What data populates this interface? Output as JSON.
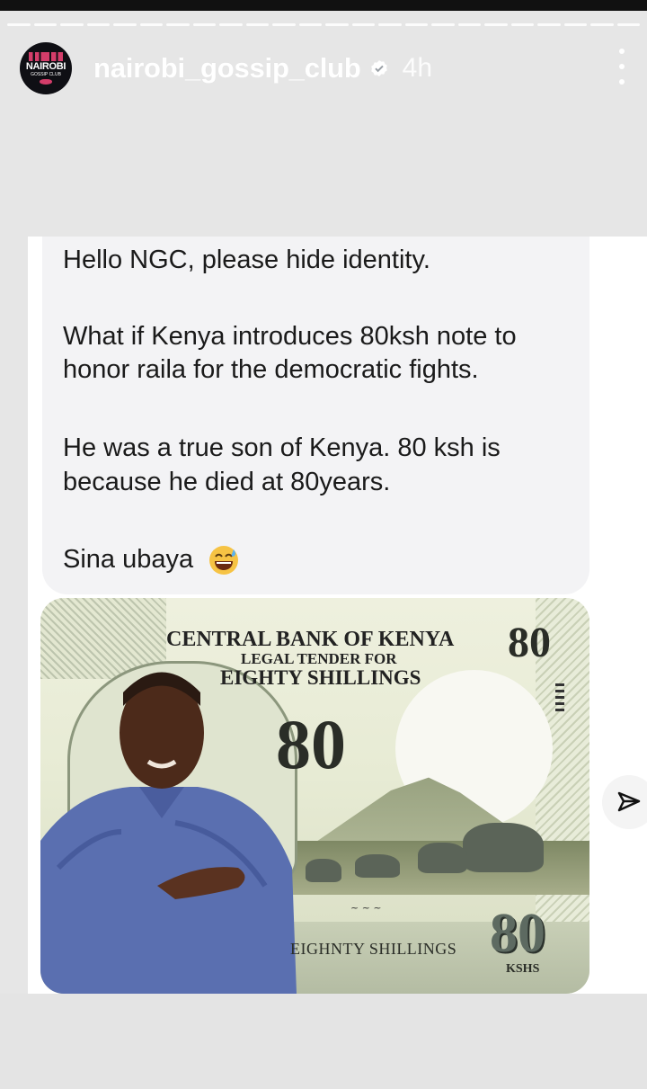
{
  "story": {
    "username": "nairobi_gossip_club",
    "time_ago": "4h",
    "avatar_text": "NAIROBI",
    "avatar_subtext": "GOSSIP CLUB",
    "progress_segments": 24
  },
  "message": {
    "lines": [
      "Hello NGC, please hide identity.",
      "What if Kenya introduces 80ksh note to",
      "honor raila for the democratic fights.",
      "He was a true son of Kenya. 80 ksh is",
      "because he died at 80years.",
      "Sina ubaya"
    ]
  },
  "banknote": {
    "bank_name": "CENTRAL BANK OF KENYA",
    "legal_tender": "LEGAL TENDER FOR",
    "denomination_words": "EIGHTY SHILLINGS",
    "value_center": "80",
    "value_top_right": "80",
    "value_bottom_right": "80",
    "currency_code": "KSHS",
    "bottom_text": "EIGHNTY SHILLINGS"
  },
  "icons": {
    "verified": "verified-badge-icon",
    "more": "more-options-icon",
    "send": "send-icon",
    "emoji": "sweat-smile-emoji"
  },
  "colors": {
    "avatar_accent": "#d43d6a",
    "bubble_bg": "#f3f3f5"
  }
}
